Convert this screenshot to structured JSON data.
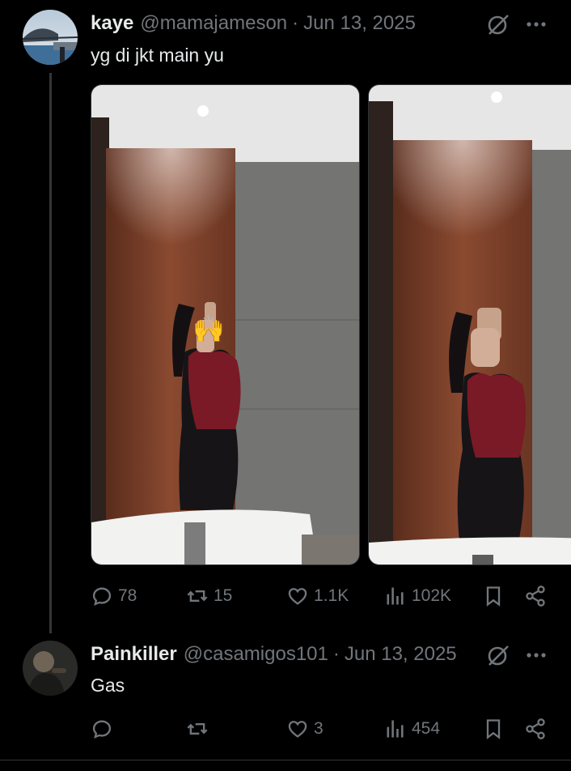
{
  "colors": {
    "background": "#000000",
    "text": "#e7e9ea",
    "muted": "#71767b",
    "divider": "#2f3336"
  },
  "post1": {
    "name": "kaye",
    "handle": "@mamajameson",
    "separator": "·",
    "date": "Jun 13, 2025",
    "text": "yg di jkt main yu",
    "actions": {
      "replies": "78",
      "reposts": "15",
      "likes": "1.1K",
      "views": "102K"
    },
    "icons": [
      "grok-icon",
      "more-icon",
      "reply-icon",
      "repost-icon",
      "like-icon",
      "views-icon",
      "bookmark-icon",
      "share-icon"
    ]
  },
  "post2": {
    "name": "Painkiller",
    "handle": "@casamigos101",
    "separator": "·",
    "date": "Jun 13, 2025",
    "text": "Gas",
    "actions": {
      "replies": "",
      "reposts": "",
      "likes": "3",
      "views": "454"
    }
  }
}
